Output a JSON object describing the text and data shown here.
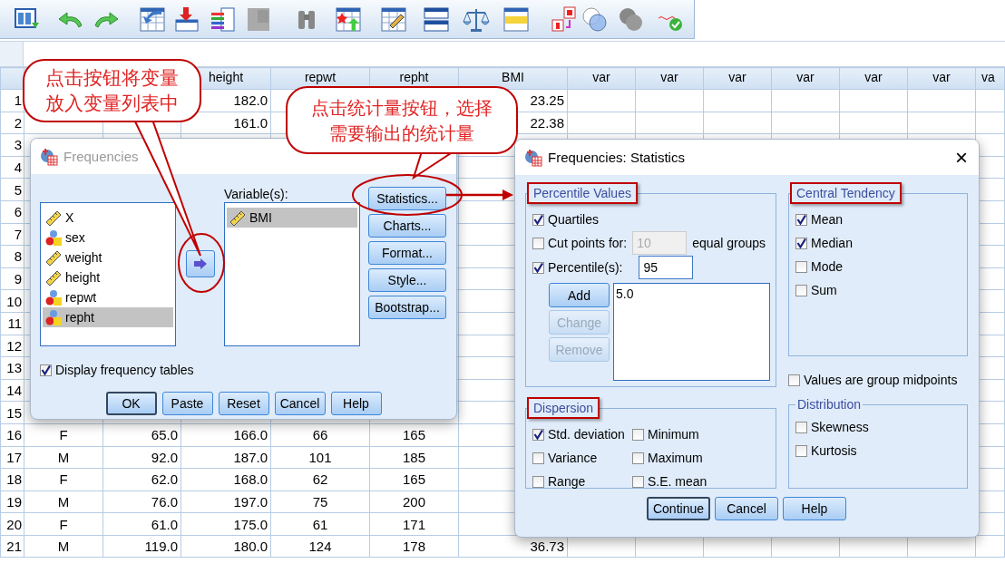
{
  "grid": {
    "columns": [
      null,
      null,
      "height",
      "repwt",
      "repht",
      "BMI",
      "var",
      "var",
      "var",
      "var",
      "var",
      "var",
      "va"
    ],
    "rows": [
      {
        "number": "1",
        "cells": [
          null,
          null,
          "182.0",
          null,
          null,
          "23.25"
        ]
      },
      {
        "number": "2",
        "cells": [
          null,
          null,
          "161.0",
          null,
          null,
          "22.38"
        ]
      },
      {
        "number": "3"
      },
      {
        "number": "4"
      },
      {
        "number": "5"
      },
      {
        "number": "6"
      },
      {
        "number": "7"
      },
      {
        "number": "8"
      },
      {
        "number": "9"
      },
      {
        "number": "10"
      },
      {
        "number": "11"
      },
      {
        "number": "12"
      },
      {
        "number": "13"
      },
      {
        "number": "14"
      },
      {
        "number": "15"
      },
      {
        "number": "16",
        "cells": [
          "F",
          "65.0",
          "166.0",
          "66",
          "165",
          null
        ]
      },
      {
        "number": "17",
        "cells": [
          "M",
          "92.0",
          "187.0",
          "101",
          "185",
          null
        ]
      },
      {
        "number": "18",
        "cells": [
          "F",
          "62.0",
          "168.0",
          "62",
          "165",
          null
        ]
      },
      {
        "number": "19",
        "cells": [
          "M",
          "76.0",
          "197.0",
          "75",
          "200",
          null
        ]
      },
      {
        "number": "20",
        "cells": [
          "F",
          "61.0",
          "175.0",
          "61",
          "171",
          null
        ]
      },
      {
        "number": "21",
        "cells": [
          "M",
          "119.0",
          "180.0",
          "124",
          "178",
          "36.73"
        ]
      }
    ]
  },
  "frequencies_dialog": {
    "title": "Frequencies",
    "active": false,
    "source_variables": [
      {
        "name": "X",
        "kind": "scale",
        "selected": false
      },
      {
        "name": "sex",
        "kind": "nominal",
        "selected": false
      },
      {
        "name": "weight",
        "kind": "scale",
        "selected": false
      },
      {
        "name": "height",
        "kind": "scale",
        "selected": false
      },
      {
        "name": "repwt",
        "kind": "nominal",
        "selected": false
      },
      {
        "name": "repht",
        "kind": "nominal",
        "selected": true
      }
    ],
    "target_label": "Variable(s):",
    "target_variables": [
      {
        "name": "BMI",
        "kind": "scale",
        "selected": true
      }
    ],
    "side_buttons": [
      "Statistics...",
      "Charts...",
      "Format...",
      "Style...",
      "Bootstrap..."
    ],
    "display_frequency_tables": {
      "label": "Display frequency tables",
      "checked": true
    },
    "buttons": [
      {
        "label": "OK",
        "default": true
      },
      {
        "label": "Paste",
        "default": false
      },
      {
        "label": "Reset",
        "default": false
      },
      {
        "label": "Cancel",
        "default": false
      },
      {
        "label": "Help",
        "default": false
      }
    ]
  },
  "statistics_dialog": {
    "title": "Frequencies: Statistics",
    "close": "×",
    "percentile_values": {
      "title": "Percentile Values",
      "highlighted": true,
      "quartiles": {
        "label": "Quartiles",
        "checked": true
      },
      "cut_points": {
        "label": "Cut points for:",
        "checked": false,
        "value": "10",
        "suffix": "equal groups"
      },
      "percentiles": {
        "label": "Percentile(s):",
        "checked": true,
        "value": "95"
      },
      "list_buttons": [
        {
          "label": "Add",
          "disabled": false
        },
        {
          "label": "Change",
          "disabled": true
        },
        {
          "label": "Remove",
          "disabled": true
        }
      ],
      "list": [
        "5.0"
      ]
    },
    "central_tendency": {
      "title": "Central Tendency",
      "highlighted": true,
      "options": [
        {
          "label": "Mean",
          "checked": true
        },
        {
          "label": "Median",
          "checked": true
        },
        {
          "label": "Mode",
          "checked": false
        },
        {
          "label": "Sum",
          "checked": false
        }
      ]
    },
    "group_midpoints": {
      "label": "Values are group midpoints",
      "checked": false
    },
    "dispersion": {
      "title": "Dispersion",
      "highlighted": true,
      "options": [
        {
          "label": "Std. deviation",
          "checked": true
        },
        {
          "label": "Minimum",
          "checked": false
        },
        {
          "label": "Variance",
          "checked": false
        },
        {
          "label": "Maximum",
          "checked": false
        },
        {
          "label": "Range",
          "checked": false
        },
        {
          "label": "S.E. mean",
          "checked": false
        }
      ]
    },
    "distribution": {
      "title": "Distribution",
      "highlighted": false,
      "options": [
        {
          "label": "Skewness",
          "checked": false
        },
        {
          "label": "Kurtosis",
          "checked": false
        }
      ]
    },
    "buttons": [
      {
        "label": "Continue",
        "default": true
      },
      {
        "label": "Cancel",
        "default": false
      },
      {
        "label": "Help",
        "default": false
      }
    ]
  },
  "callouts": [
    {
      "text": "点击按钮将变量放入变量列表中"
    },
    {
      "text": "点击统计量按钮，选择需要输出的统计量"
    }
  ]
}
